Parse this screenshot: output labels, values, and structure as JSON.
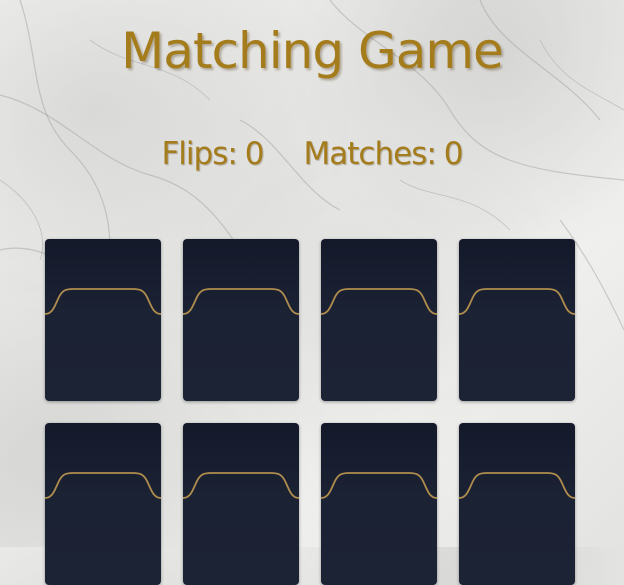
{
  "game": {
    "title": "Matching Game",
    "flips_label": "Flips:",
    "flips_value": "0",
    "matches_label": "Matches:",
    "matches_value": "0"
  },
  "colors": {
    "accent_gold": "#a57c1b",
    "card_back": "#1c2334",
    "card_trim": "#b08d4e"
  },
  "cards": [
    {
      "state": "face-down"
    },
    {
      "state": "face-down"
    },
    {
      "state": "face-down"
    },
    {
      "state": "face-down"
    },
    {
      "state": "face-down"
    },
    {
      "state": "face-down"
    },
    {
      "state": "face-down"
    },
    {
      "state": "face-down"
    }
  ]
}
